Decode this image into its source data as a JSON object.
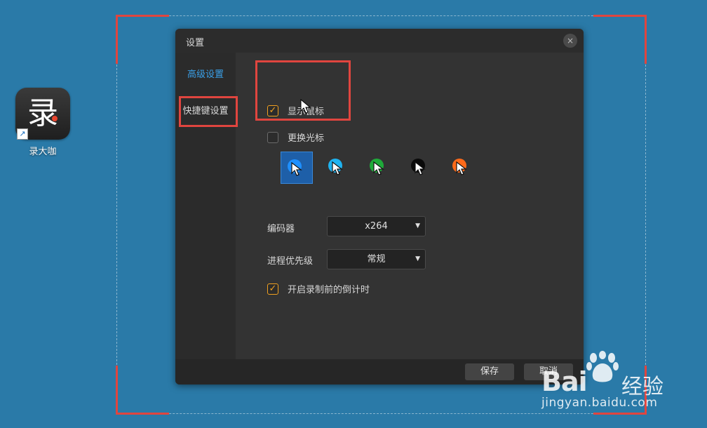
{
  "desktop": {
    "app_icon_glyph": "录",
    "app_label": "录大咖"
  },
  "dialog": {
    "title": "设置",
    "close_glyph": "×",
    "sidebar": {
      "items": [
        {
          "label": "高级设置",
          "active": true
        },
        {
          "label": "快捷键设置",
          "active": false
        }
      ]
    },
    "show_cursor": {
      "label": "显示鼠标",
      "checked": true
    },
    "change_cursor": {
      "label": "更换光标",
      "checked": false
    },
    "cursor_styles": [
      {
        "icon": "cursor-blue-icon",
        "color": "#1e90ff",
        "selected": true
      },
      {
        "icon": "cursor-cyan-icon",
        "color": "#1fb3f0",
        "selected": false
      },
      {
        "icon": "cursor-green-icon",
        "color": "#1faa3a",
        "selected": false
      },
      {
        "icon": "cursor-black-icon",
        "color": "#0a0a0a",
        "selected": false
      },
      {
        "icon": "cursor-orange-icon",
        "color": "#ff6a1a",
        "selected": false
      }
    ],
    "encoder": {
      "label": "编码器",
      "value": "x264"
    },
    "priority": {
      "label": "进程优先级",
      "value": "常规"
    },
    "countdown": {
      "label": "开启录制前的倒计时",
      "checked": true
    },
    "footer": {
      "save_label": "保存",
      "cancel_label": "取消"
    }
  },
  "watermark": {
    "brand_left": "Bai",
    "brand_right": "经验",
    "url": "jingyan.baidu.com"
  },
  "colors": {
    "desktop_bg": "#2a7aa8",
    "accent": "#f0a020",
    "active_tab": "#3aa0e8",
    "highlight_box": "#e0453f"
  }
}
